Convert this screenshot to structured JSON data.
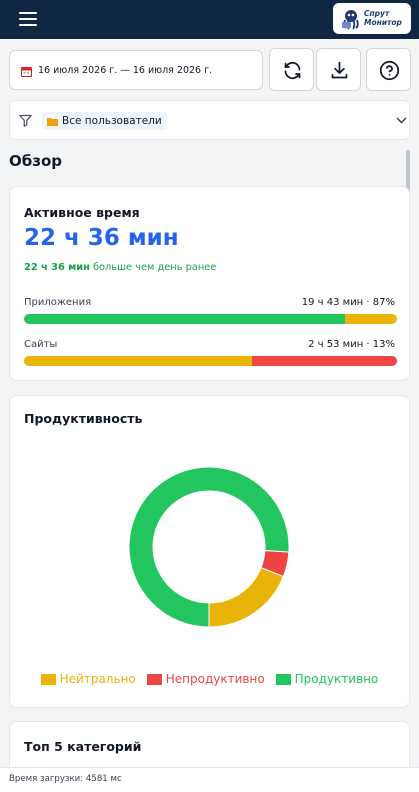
{
  "header": {
    "menu_icon": "hamburger-menu-icon",
    "logo": {
      "line1": "Спрут",
      "line2": "Монитор",
      "icon": "octopus-logo-icon"
    }
  },
  "toolbar": {
    "date_range": "16 июля 2026 г. — 16 июля 2026 г.",
    "calendar_icon": "calendar-icon",
    "refresh_icon": "refresh-icon",
    "download_icon": "download-icon",
    "help_icon": "help-circle-icon"
  },
  "filter": {
    "filter_icon": "filter-icon",
    "chip_icon": "folder-icon",
    "chip_label": "Все пользователи",
    "expand_icon": "chevron-down-icon"
  },
  "overview": {
    "title": "Обзор",
    "active_time": {
      "title": "Активное время",
      "value": "22 ч 36 мин",
      "compare_value": "22 ч 36 мин",
      "compare_text": "больше чем день ранее",
      "rows": [
        {
          "label": "Приложения",
          "value": "19 ч 43 мин · 87%",
          "segments": [
            {
              "color": "#22c55e",
              "share": 0.86
            },
            {
              "color": "#eab308",
              "share": 0.14
            }
          ]
        },
        {
          "label": "Сайты",
          "value": "2 ч 53 мин · 13%",
          "segments": [
            {
              "color": "#eab308",
              "share": 0.61
            },
            {
              "color": "#ef4444",
              "share": 0.39
            }
          ]
        }
      ]
    },
    "productivity": {
      "title": "Продуктивность",
      "legend": [
        {
          "label": "Нейтрально",
          "color": "#eab308"
        },
        {
          "label": "Непродуктивно",
          "color": "#ef4444"
        },
        {
          "label": "Продуктивно",
          "color": "#22c55e"
        }
      ]
    },
    "top_categories": {
      "title": "Топ 5 категорий"
    }
  },
  "chart_data": {
    "type": "pie",
    "donut": true,
    "title": "Продуктивность",
    "categories": [
      "Нейтрально",
      "Непродуктивно",
      "Продуктивно"
    ],
    "values": [
      19,
      5,
      76
    ],
    "colors": [
      "#eab308",
      "#ef4444",
      "#22c55e"
    ],
    "legend_position": "bottom"
  },
  "footer": {
    "load_time": "Время загрузки: 4581 мс"
  }
}
